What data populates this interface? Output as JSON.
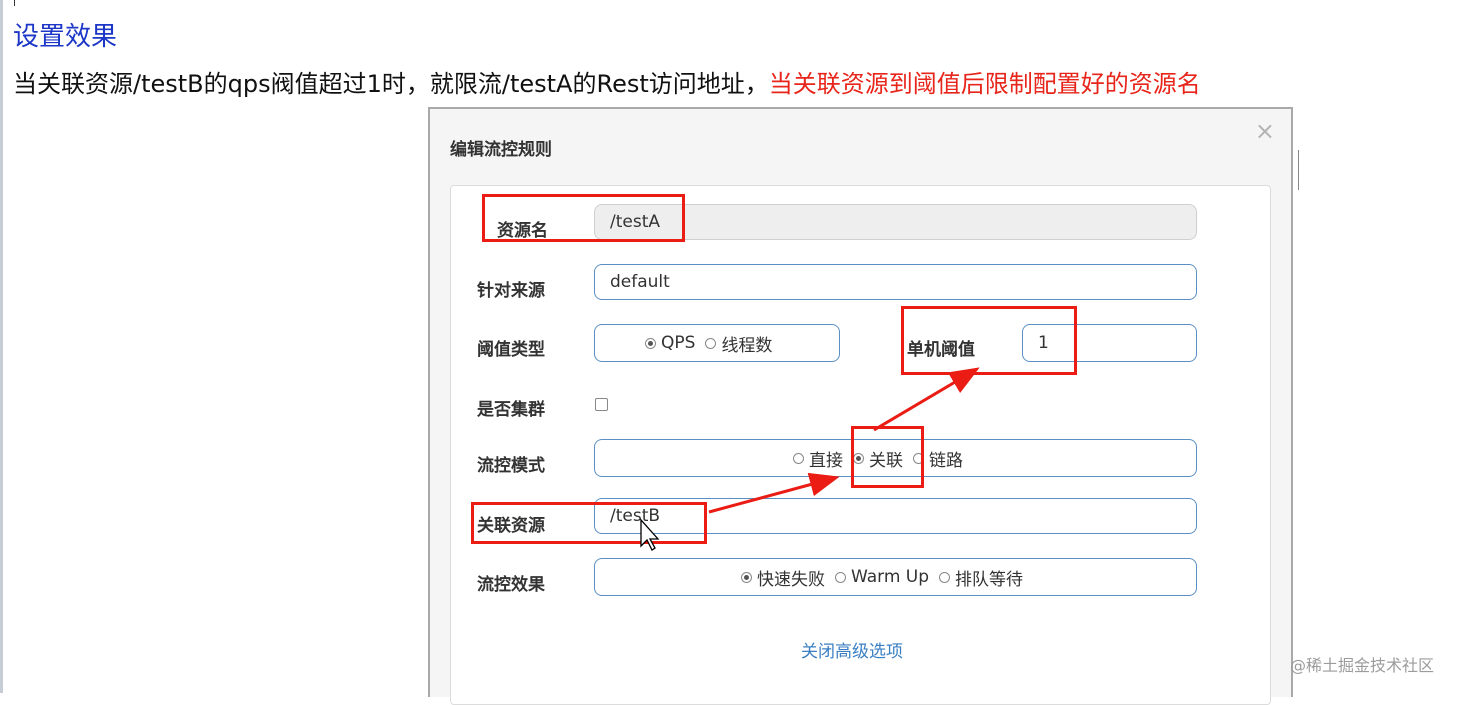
{
  "heading": "设置效果",
  "description": {
    "black_part": "当关联资源/testB的qps阀值超过1时，就限流/testA的Rest访问地址，",
    "red_part": "当关联资源到阈值后限制配置好的资源名"
  },
  "dialog": {
    "title": "编辑流控规则",
    "close_symbol": "×",
    "resource_name": {
      "label": "资源名",
      "value": "/testA"
    },
    "limit_app": {
      "label": "针对来源",
      "value": "default"
    },
    "threshold_type": {
      "label": "阈值类型",
      "options": [
        "QPS",
        "线程数"
      ],
      "selected": "QPS"
    },
    "single_threshold": {
      "label": "单机阈值",
      "value": "1"
    },
    "cluster": {
      "label": "是否集群",
      "checked": false
    },
    "strategy": {
      "label": "流控模式",
      "options": [
        "直接",
        "关联",
        "链路"
      ],
      "selected": "关联"
    },
    "ref_resource": {
      "label": "关联资源",
      "value": "/testB"
    },
    "control_behavior": {
      "label": "流控效果",
      "options": [
        "快速失败",
        "Warm Up",
        "排队等待"
      ],
      "selected": "快速失败"
    },
    "advanced_toggle": "关闭高级选项"
  },
  "watermark": "@稀土掘金技术社区",
  "colors": {
    "highlight": "#ea1c14",
    "link": "#3a7fc3",
    "heading": "#1c37c8",
    "input_border": "#5a8fc4"
  }
}
